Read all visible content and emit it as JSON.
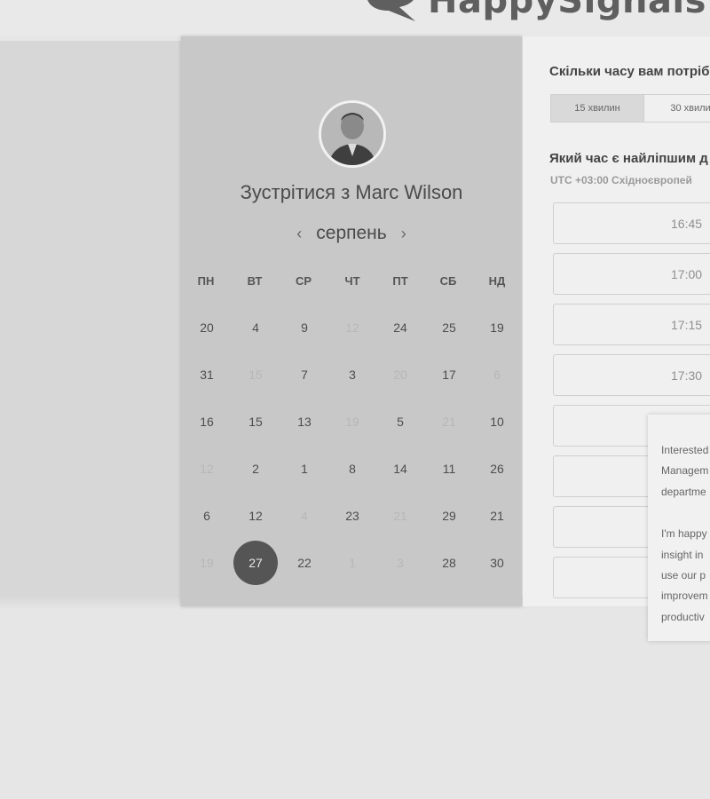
{
  "brand": {
    "name": "HappySignals"
  },
  "calendar": {
    "title": "Зустрітися з Marc Wilson",
    "month": "серпень",
    "prev_symbol": "‹",
    "next_symbol": "›",
    "weekdays": [
      "ПН",
      "ВТ",
      "СР",
      "ЧТ",
      "ПТ",
      "СБ",
      "НД"
    ],
    "weeks": [
      [
        "20",
        "4",
        "9",
        "12",
        "24",
        "25",
        "19"
      ],
      [
        "31",
        "15",
        "7",
        "3",
        "20",
        "17",
        "6"
      ],
      [
        "16",
        "15",
        "13",
        "19",
        "5",
        "21",
        "10"
      ],
      [
        "12",
        "2",
        "1",
        "8",
        "14",
        "11",
        "26"
      ],
      [
        "6",
        "12",
        "4",
        "23",
        "21",
        "29",
        "21"
      ],
      [
        "19",
        "27",
        "22",
        "1",
        "3",
        "28",
        "30"
      ]
    ]
  },
  "booking": {
    "duration_question": "Скільки часу вам потріб",
    "durations": [
      "15 хвилин",
      "30 хвили"
    ],
    "selected_duration": "15 хвилин",
    "time_question": "Який час є найліпшим д",
    "timezone": "UTC +03:00 Східноєвропей",
    "time_slots": [
      "16:45",
      "17:00",
      "17:15",
      "17:30",
      "",
      "",
      "",
      ""
    ]
  },
  "popup": {
    "lines": [
      "Interested",
      "Managem",
      "departme",
      "",
      "I'm happy",
      "insight in",
      "use our p",
      "improvem",
      "productiv"
    ]
  },
  "colors": {
    "selected_day": "#555555",
    "panel": "#c8c8c8"
  }
}
